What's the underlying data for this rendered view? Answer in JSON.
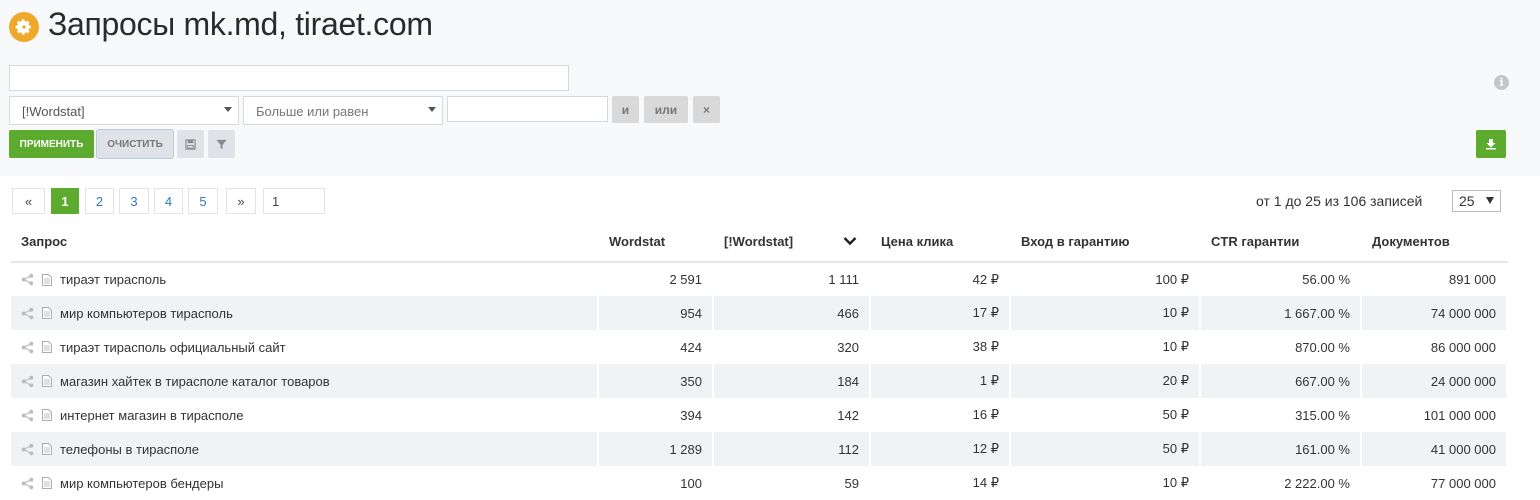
{
  "header": {
    "title": "Запросы mk.md, tiraet.com"
  },
  "filters": {
    "search_value": "",
    "field_select": "[!Wordstat]",
    "operator_select": "Больше или равен",
    "value_input": "",
    "and_label": "и",
    "or_label": "или",
    "remove_label": "×",
    "info_label": "i"
  },
  "actions": {
    "apply_label": "ПРИМЕНИТЬ",
    "clear_label": "ОЧИСТИТЬ"
  },
  "pagination": {
    "prev": "«",
    "pages": [
      "1",
      "2",
      "3",
      "4",
      "5"
    ],
    "next": "»",
    "goto_value": "1",
    "records_text": "от 1 до 25 из 106 записей",
    "per_page": "25"
  },
  "table": {
    "headers": {
      "query": "Запрос",
      "wordstat": "Wordstat",
      "exact_wordstat": "[!Wordstat]",
      "click_price": "Цена клика",
      "guarantee_entry": "Вход в гарантию",
      "ctr_guarantee": "CTR гарантии",
      "documents": "Документов"
    },
    "rows": [
      {
        "query": "тираэт тирасполь",
        "wordstat": "2 591",
        "exact": "1 111",
        "price": "42 ₽",
        "entry": "100 ₽",
        "ctr": "56.00 %",
        "docs": "891 000"
      },
      {
        "query": "мир компьютеров тирасполь",
        "wordstat": "954",
        "exact": "466",
        "price": "17 ₽",
        "entry": "10 ₽",
        "ctr": "1 667.00 %",
        "docs": "74 000 000"
      },
      {
        "query": "тираэт тирасполь официальный сайт",
        "wordstat": "424",
        "exact": "320",
        "price": "38 ₽",
        "entry": "10 ₽",
        "ctr": "870.00 %",
        "docs": "86 000 000"
      },
      {
        "query": "магазин хайтек в тирасполе каталог товаров",
        "wordstat": "350",
        "exact": "184",
        "price": "1 ₽",
        "entry": "20 ₽",
        "ctr": "667.00 %",
        "docs": "24 000 000"
      },
      {
        "query": "интернет магазин в тирасполе",
        "wordstat": "394",
        "exact": "142",
        "price": "16 ₽",
        "entry": "50 ₽",
        "ctr": "315.00 %",
        "docs": "101 000 000"
      },
      {
        "query": "телефоны в тирасполе",
        "wordstat": "1 289",
        "exact": "112",
        "price": "12 ₽",
        "entry": "50 ₽",
        "ctr": "161.00 %",
        "docs": "41 000 000"
      },
      {
        "query": "мир компьютеров бендеры",
        "wordstat": "100",
        "exact": "59",
        "price": "14 ₽",
        "entry": "10 ₽",
        "ctr": "2 222.00 %",
        "docs": "77 000 000"
      }
    ]
  },
  "colors": {
    "accent_green": "#5cab2e",
    "title_icon": "#f0a82b"
  }
}
